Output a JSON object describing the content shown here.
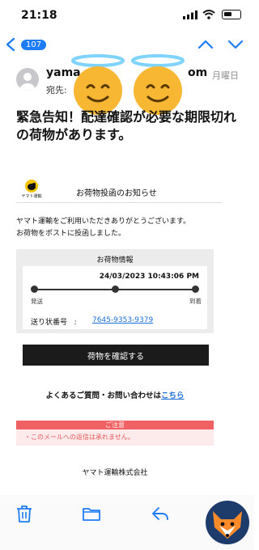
{
  "status": {
    "time": "21:18"
  },
  "nav": {
    "count": "107"
  },
  "header": {
    "sender_prefix": "yama",
    "sender_suffix": "om",
    "date": "月曜日",
    "to_label": "宛先:"
  },
  "subject": "緊急告知！配達確認が必要な期限切れの荷物があります。",
  "card": {
    "logo_text": "ヤマト運輸",
    "title": "お荷物投函のお知らせ",
    "greeting_line1": "ヤマト運輸をご利用いただきありがとうございます。",
    "greeting_line2": "お荷物をポストに投函しました。",
    "info_title": "お荷物情報",
    "datetime": "24/03/2023 10:43:06 PM",
    "step_start": "発送",
    "step_end": "到着",
    "tracking_label": "送り状番号",
    "tracking_sep": ":",
    "tracking_number": "7645-9353-9379",
    "confirm_button": "荷物を確認する",
    "faq_text": "よくあるご質問・お問い合わせは",
    "faq_link": "こちら",
    "notice_title": "ご注意",
    "notice_body": "・このメールへの返信は承れません。",
    "company": "ヤマト運輸株式会社"
  },
  "progress": {
    "fraction": 1.0
  },
  "colors": {
    "accent": "#1e7cf6",
    "link": "#1e6fd9",
    "notice": "#f06163",
    "button": "#1b1b1b"
  },
  "icons": [
    "back-chevron-icon",
    "up-chevron-icon",
    "down-chevron-icon",
    "trash-icon",
    "folder-icon",
    "reply-icon"
  ]
}
